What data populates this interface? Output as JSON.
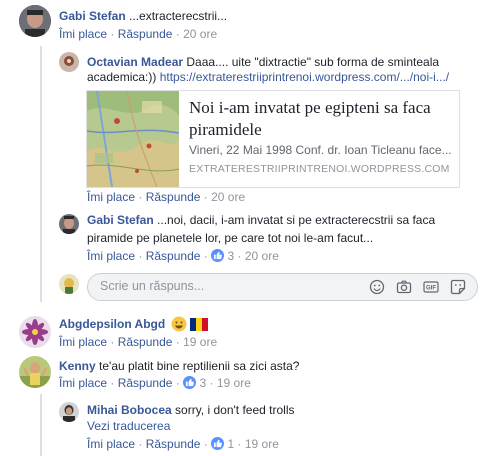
{
  "comments": [
    {
      "author": "Gabi Stefan",
      "text": "...extracterecstrii...",
      "like": "Îmi place",
      "reply": "Răspunde",
      "time": "20 ore"
    },
    {
      "author": "Octavian Madear",
      "text_line1": "Daaa.... uite \"dixtractie\" sub forma de sminteala",
      "text_line2_plain": "academica:)) ",
      "text_line2_link": "https://extraterestriiprintrenoi.wordpress.com/.../noi-i.../",
      "preview": {
        "title": "Noi i-am invatat pe egipteni sa faca piramidele",
        "description": "Vineri, 22 Mai 1998 Conf. dr. Ioan Ticleanu face...",
        "domain": "EXTRATERESTRIIPRINTRENOI.WORDPRESS.COM"
      },
      "like": "Îmi place",
      "reply": "Răspunde",
      "time": "20 ore"
    },
    {
      "author": "Gabi Stefan",
      "text_line1": "...noi, dacii, i-am invatat si pe extracterecstrii sa faca",
      "text_line2": "piramide pe planetele lor, pe care tot noi le-am facut...",
      "like": "Îmi place",
      "reply": "Răspunde",
      "likes_count": "3",
      "time": "20 ore"
    },
    {
      "reply_placeholder": "Scrie un răspuns..."
    },
    {
      "author": "Abgdepsilon Abgd",
      "like": "Îmi place",
      "reply": "Răspunde",
      "time": "19 ore"
    },
    {
      "author": "Kenny",
      "text": "te'au platit bine reptilienii sa zici asta?",
      "like": "Îmi place",
      "reply": "Răspunde",
      "likes_count": "3",
      "time": "19 ore"
    },
    {
      "author": "Mihai Bobocea",
      "text": "sorry, i don't feed trolls",
      "translate": "Vezi traducerea",
      "like": "Îmi place",
      "reply": "Răspunde",
      "likes_count": "1",
      "time": "19 ore"
    }
  ],
  "colors": {
    "link": "#385898",
    "meta": "#90949c",
    "like_badge": "#5890ff"
  },
  "icons": [
    "emoji-icon",
    "camera-icon",
    "gif-icon",
    "sticker-icon",
    "smiley-emoji-icon",
    "romania-flag-icon",
    "like-icon"
  ]
}
